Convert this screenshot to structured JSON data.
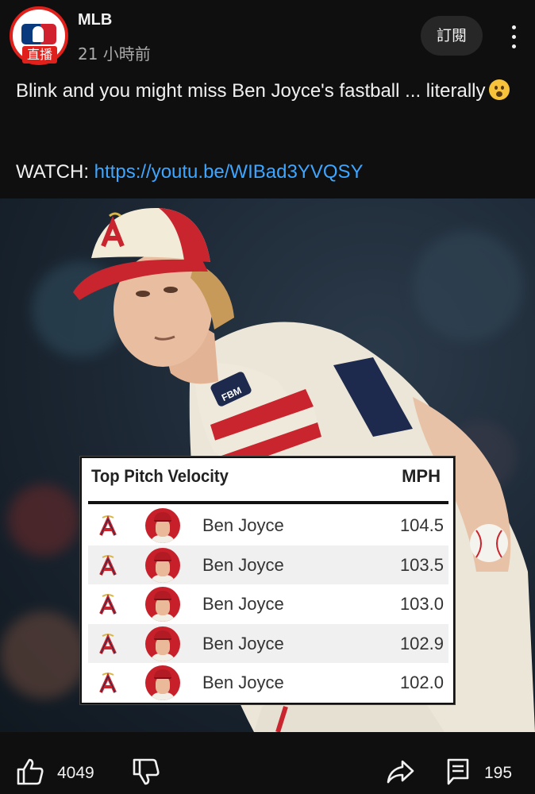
{
  "channel": {
    "name": "MLB",
    "live_badge": "直播",
    "time": "21 小時前",
    "subscribe_label": "訂閱"
  },
  "post": {
    "text": "Blink and you might miss Ben Joyce's fastball ... literally",
    "watch_label": "WATCH:",
    "watch_link": "https://youtu.be/WIBad3YVQSY"
  },
  "image": {
    "patch_text": "FBM",
    "stats_card": {
      "title": "Top Pitch Velocity",
      "unit_header": "MPH",
      "rows": [
        {
          "team_icon": "angels-logo-icon",
          "player": "Ben Joyce",
          "mph": "104.5"
        },
        {
          "team_icon": "angels-logo-icon",
          "player": "Ben Joyce",
          "mph": "103.5"
        },
        {
          "team_icon": "angels-logo-icon",
          "player": "Ben Joyce",
          "mph": "103.0"
        },
        {
          "team_icon": "angels-logo-icon",
          "player": "Ben Joyce",
          "mph": "102.9"
        },
        {
          "team_icon": "angels-logo-icon",
          "player": "Ben Joyce",
          "mph": "102.0"
        }
      ]
    }
  },
  "actions": {
    "like_count": "4049",
    "comment_count": "195"
  },
  "colors": {
    "background": "#0f0f0f",
    "link": "#3ea6ff",
    "live_red": "#e0201b",
    "angels_red": "#c8202b"
  }
}
